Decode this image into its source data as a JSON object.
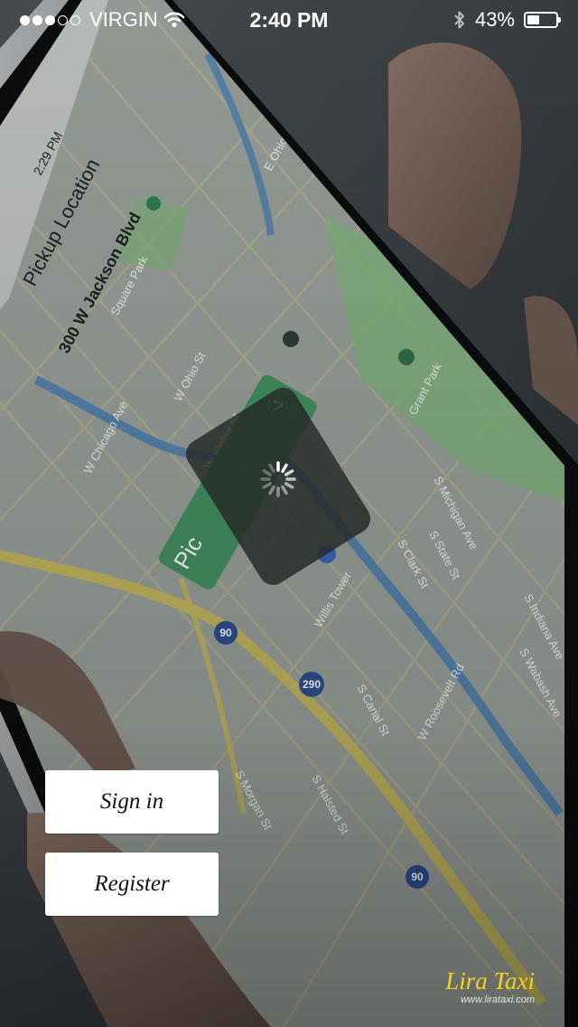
{
  "status_bar": {
    "carrier": "VIRGIN",
    "signal_bars": 3,
    "signal_max": 5,
    "time": "2:40 PM",
    "battery": "43%",
    "battery_level": 0.43,
    "icons": [
      "signal-dots-icon",
      "wifi-icon",
      "bluetooth-icon",
      "battery-icon"
    ]
  },
  "background_phone": {
    "time": "2:29 PM",
    "pickup_title": "Pickup Location",
    "pickup_address": "300 W Jackson Blvd",
    "streets": [
      "W Chicago Ave",
      "W Ohio St",
      "W Kinzie St",
      "Square Park",
      "S Clark St",
      "S State St",
      "S Michigan Ave",
      "S Indiana Ave",
      "S Wabash Ave",
      "Willis Tower",
      "S Canal St",
      "S Halsted St",
      "S Morgan St",
      "W Roosevelt Rd",
      "Grant Park",
      "E Ohio St"
    ],
    "highway_shields": [
      "90",
      "290",
      "90"
    ],
    "pin_label": "Pic",
    "pin_chevron": ">",
    "icons": [
      "spinner-icon",
      "location-pin-icon"
    ]
  },
  "actions": {
    "sign_in": "Sign in",
    "register": "Register"
  },
  "brand": {
    "name": "Lira Taxi",
    "url": "www.lirataxi.com"
  },
  "colors": {
    "brand_yellow": "#f4d31c",
    "button_bg": "#ffffff",
    "status_text": "#ffffff",
    "map_green": "#3c8f58",
    "map_water": "#3e6f9e",
    "map_road": "#b8a95a"
  }
}
